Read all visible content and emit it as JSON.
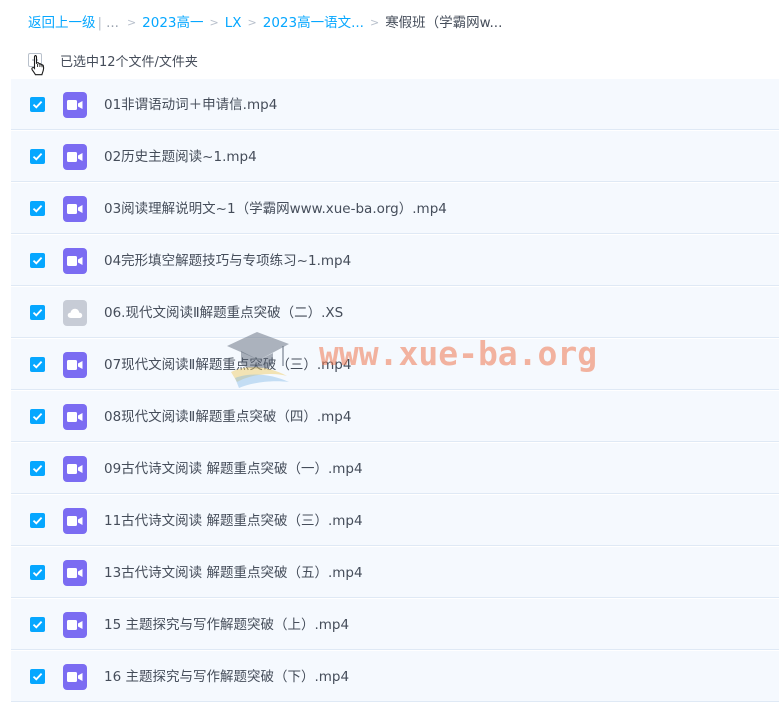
{
  "breadcrumb": {
    "back": "返回上一级",
    "ellipsis": "...",
    "items": [
      "2023高一",
      "LX",
      "2023高一语文..."
    ],
    "current": "寒假班（学霸网w..."
  },
  "selection": {
    "text": "已选中12个文件/文件夹"
  },
  "files": [
    {
      "name": "01非谓语动词＋申请信.mp4",
      "icon": "video-icon",
      "checked": true
    },
    {
      "name": "02历史主题阅读~1.mp4",
      "icon": "video-icon",
      "checked": true
    },
    {
      "name": "03阅读理解说明文~1（学霸网www.xue-ba.org）.mp4",
      "icon": "video-icon",
      "checked": true
    },
    {
      "name": "04完形填空解题技巧与专项练习~1.mp4",
      "icon": "video-icon",
      "checked": true
    },
    {
      "name": "06.现代文阅读Ⅱ解题重点突破（二）.XS",
      "icon": "cloud-file-icon",
      "checked": true
    },
    {
      "name": "07现代文阅读Ⅱ解题重点突破（三）.mp4",
      "icon": "video-icon",
      "checked": true
    },
    {
      "name": "08现代文阅读Ⅱ解题重点突破（四）.mp4",
      "icon": "video-icon",
      "checked": true
    },
    {
      "name": "09古代诗文阅读 解题重点突破（一）.mp4",
      "icon": "video-icon",
      "checked": true
    },
    {
      "name": "11古代诗文阅读 解题重点突破（三）.mp4",
      "icon": "video-icon",
      "checked": true
    },
    {
      "name": "13古代诗文阅读 解题重点突破（五）.mp4",
      "icon": "video-icon",
      "checked": true
    },
    {
      "name": "15 主题探究与写作解题突破（上）.mp4",
      "icon": "video-icon",
      "checked": true
    },
    {
      "name": "16 主题探究与写作解题突破（下）.mp4",
      "icon": "video-icon",
      "checked": true
    }
  ],
  "watermark": {
    "text": "www.xue-ba.org"
  },
  "colors": {
    "accent": "#06a7ff",
    "video_icon": "#7b6cf2",
    "cloud_icon": "#c7ccd6",
    "row_bg": "#f5f9fe"
  }
}
